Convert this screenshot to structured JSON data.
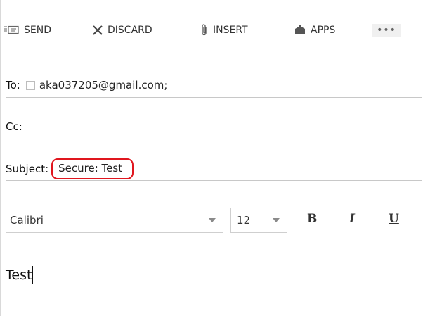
{
  "toolbar": {
    "send_label": "SEND",
    "send_icon": "send-icon",
    "discard_label": "DISCARD",
    "discard_icon": "close-icon",
    "insert_label": "INSERT",
    "insert_icon": "paperclip-icon",
    "apps_label": "APPS",
    "apps_icon": "apps-icon",
    "more_label": "•••"
  },
  "fields": {
    "to_label": "To:",
    "to_recipient": "aka037205@gmail.com;",
    "cc_label": "Cc:",
    "subject_label": "Subject:",
    "subject_value": "Secure: Test",
    "highlight_color": "#e0161e"
  },
  "format": {
    "font": "Calibri",
    "size": "12",
    "bold": "B",
    "italic": "I",
    "underline": "U"
  },
  "body": {
    "text": "Test"
  }
}
